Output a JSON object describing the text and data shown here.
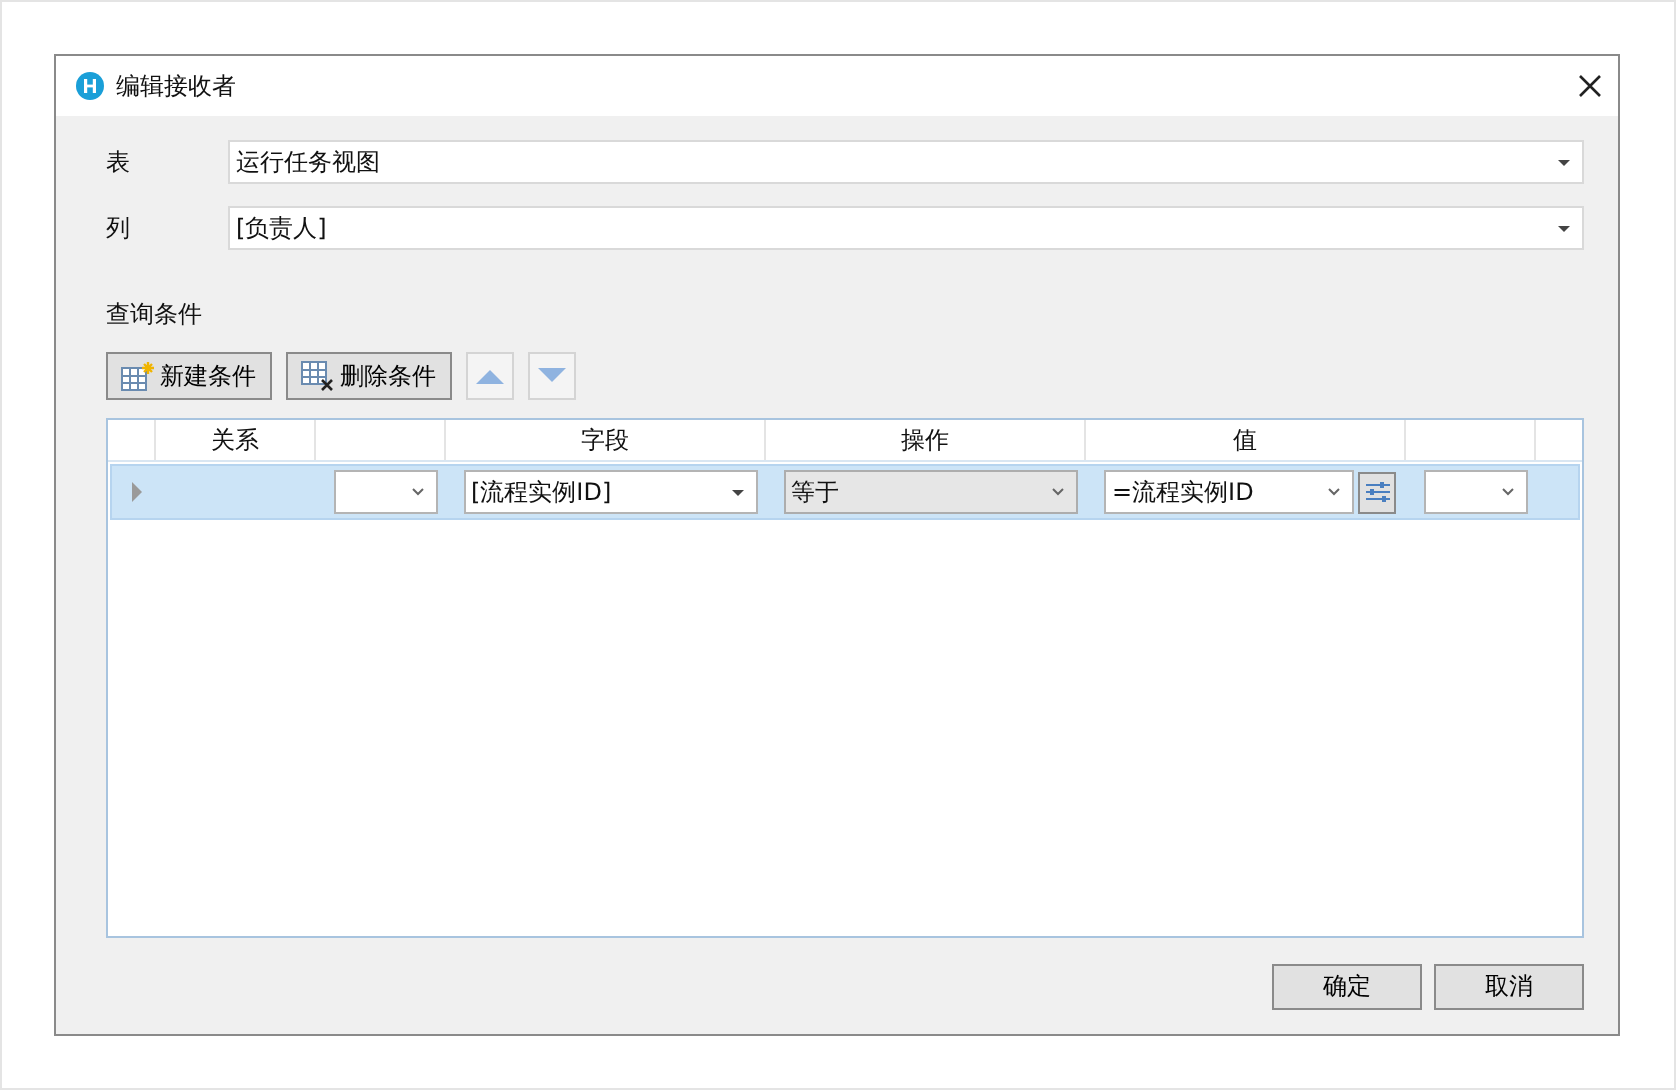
{
  "window": {
    "title": "编辑接收者"
  },
  "fields": [
    {
      "label": "表",
      "value": "运行任务视图"
    },
    {
      "label": "列",
      "value": "[负责人]"
    }
  ],
  "conditions": {
    "label": "查询条件",
    "toolbar": [
      {
        "kind": "new",
        "label": "新建条件"
      },
      {
        "kind": "delete",
        "label": "删除条件"
      },
      {
        "kind": "up"
      },
      {
        "kind": "down"
      }
    ],
    "columns": [
      "关系",
      "字段",
      "操作",
      "值"
    ],
    "rows": [
      {
        "selected": true,
        "field": "[流程实例ID]",
        "operator": "等于",
        "value": "=流程实例ID"
      }
    ]
  },
  "buttons": [
    "确定",
    "取消"
  ]
}
